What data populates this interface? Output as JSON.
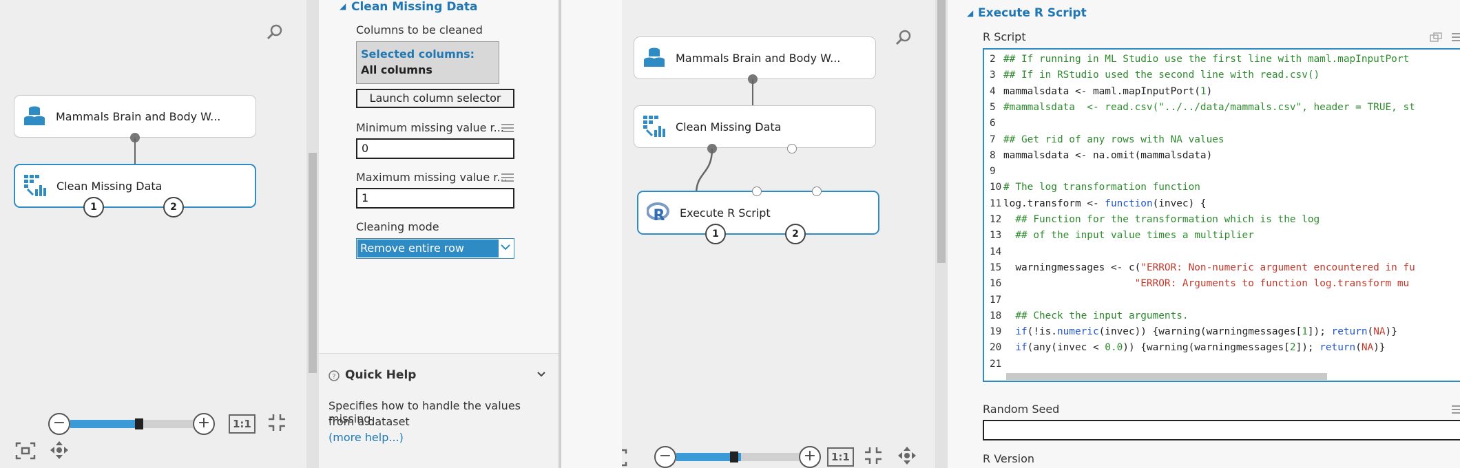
{
  "left_canvas": {
    "module_dataset": "Mammals Brain and Body W...",
    "module_clean": "Clean Missing Data",
    "port1": "1",
    "port2": "2",
    "zoom_fit_label": "1:1"
  },
  "clean_props": {
    "section_title": "Clean Missing Data",
    "columns_label": "Columns to be cleaned",
    "selected_columns_label": "Selected columns:",
    "selected_columns_value": "All columns",
    "launch_button": "Launch column selector",
    "min_label": "Minimum missing value r...",
    "min_value": "0",
    "max_label": "Maximum missing value r...",
    "max_value": "1",
    "cleaning_mode_label": "Cleaning mode",
    "cleaning_mode_value": "Remove entire row",
    "quick_help_title": "Quick Help",
    "quick_help_text_1": "Specifies how to handle the values missing",
    "quick_help_text_2": "from a dataset",
    "more_help": "(more help...)"
  },
  "right_canvas": {
    "module_dataset": "Mammals Brain and Body W...",
    "module_clean": "Clean Missing Data",
    "module_r": "Execute R Script",
    "port1": "1",
    "port2": "2",
    "zoom_fit_label": "1:1"
  },
  "r_props": {
    "section_title": "Execute R Script",
    "r_script_label": "R Script",
    "random_seed_label": "Random Seed",
    "r_version_label": "R Version",
    "code_lines": [
      {
        "n": "2",
        "parts": [
          {
            "t": "## If running in ML Studio use the first line with maml.mapInputPort",
            "c": "c-com"
          }
        ]
      },
      {
        "n": "3",
        "parts": [
          {
            "t": "## If in RStudio used the second line with read.csv()",
            "c": "c-com"
          }
        ]
      },
      {
        "n": "4",
        "parts": [
          {
            "t": "mammalsdata <- maml.mapInputPort(",
            "c": "c-plain"
          },
          {
            "t": "1",
            "c": "c-com"
          },
          {
            "t": ")",
            "c": "c-plain"
          }
        ]
      },
      {
        "n": "5",
        "parts": [
          {
            "t": "#mammalsdata  <- read.csv(\"../../data/mammals.csv\", header = TRUE, st",
            "c": "c-com"
          }
        ]
      },
      {
        "n": "6",
        "parts": [
          {
            "t": "",
            "c": "c-plain"
          }
        ]
      },
      {
        "n": "7",
        "parts": [
          {
            "t": "## Get rid of any rows with NA values",
            "c": "c-com"
          }
        ]
      },
      {
        "n": "8",
        "parts": [
          {
            "t": "mammalsdata <- na.omit(mammalsdata)",
            "c": "c-plain"
          }
        ]
      },
      {
        "n": "9",
        "parts": [
          {
            "t": "",
            "c": "c-plain"
          }
        ]
      },
      {
        "n": "10",
        "parts": [
          {
            "t": "# The log transformation function",
            "c": "c-com"
          }
        ]
      },
      {
        "n": "11",
        "parts": [
          {
            "t": "log.transform <- ",
            "c": "c-plain"
          },
          {
            "t": "function",
            "c": "c-kw"
          },
          {
            "t": "(invec) {",
            "c": "c-plain"
          }
        ]
      },
      {
        "n": "12",
        "parts": [
          {
            "t": "  ## Function for the transformation which is the log",
            "c": "c-com"
          }
        ]
      },
      {
        "n": "13",
        "parts": [
          {
            "t": "  ## of the input value times a multiplier",
            "c": "c-com"
          }
        ]
      },
      {
        "n": "14",
        "parts": [
          {
            "t": "",
            "c": "c-plain"
          }
        ]
      },
      {
        "n": "15",
        "parts": [
          {
            "t": "  warningmessages <- c(",
            "c": "c-plain"
          },
          {
            "t": "\"ERROR: Non-numeric argument encountered in fu",
            "c": "c-str"
          }
        ]
      },
      {
        "n": "16",
        "parts": [
          {
            "t": "                      ",
            "c": "c-plain"
          },
          {
            "t": "\"ERROR: Arguments to function log.transform mu",
            "c": "c-str"
          }
        ]
      },
      {
        "n": "17",
        "parts": [
          {
            "t": "",
            "c": "c-plain"
          }
        ]
      },
      {
        "n": "18",
        "parts": [
          {
            "t": "  ## Check the input arguments.",
            "c": "c-com"
          }
        ]
      },
      {
        "n": "19",
        "parts": [
          {
            "t": "  ",
            "c": "c-plain"
          },
          {
            "t": "if",
            "c": "c-kw"
          },
          {
            "t": "(!is.",
            "c": "c-plain"
          },
          {
            "t": "numeric",
            "c": "c-kw"
          },
          {
            "t": "(invec)) {warning(warningmessages[",
            "c": "c-plain"
          },
          {
            "t": "1",
            "c": "c-com"
          },
          {
            "t": "]); ",
            "c": "c-plain"
          },
          {
            "t": "return",
            "c": "c-kw"
          },
          {
            "t": "(",
            "c": "c-plain"
          },
          {
            "t": "NA",
            "c": "c-str"
          },
          {
            "t": ")}",
            "c": "c-plain"
          }
        ]
      },
      {
        "n": "20",
        "parts": [
          {
            "t": "  ",
            "c": "c-plain"
          },
          {
            "t": "if",
            "c": "c-kw"
          },
          {
            "t": "(any(invec < ",
            "c": "c-plain"
          },
          {
            "t": "0.0",
            "c": "c-com"
          },
          {
            "t": ")) {warning(warningmessages[",
            "c": "c-plain"
          },
          {
            "t": "2",
            "c": "c-com"
          },
          {
            "t": "]); ",
            "c": "c-plain"
          },
          {
            "t": "return",
            "c": "c-kw"
          },
          {
            "t": "(",
            "c": "c-plain"
          },
          {
            "t": "NA",
            "c": "c-str"
          },
          {
            "t": ")}",
            "c": "c-plain"
          }
        ]
      },
      {
        "n": "21",
        "parts": [
          {
            "t": "",
            "c": "c-plain"
          }
        ]
      }
    ]
  },
  "colors": {
    "accent": "#2f8bc3",
    "heading_blue": "#1f78b4",
    "zoom_blue": "#3b9ad6"
  }
}
